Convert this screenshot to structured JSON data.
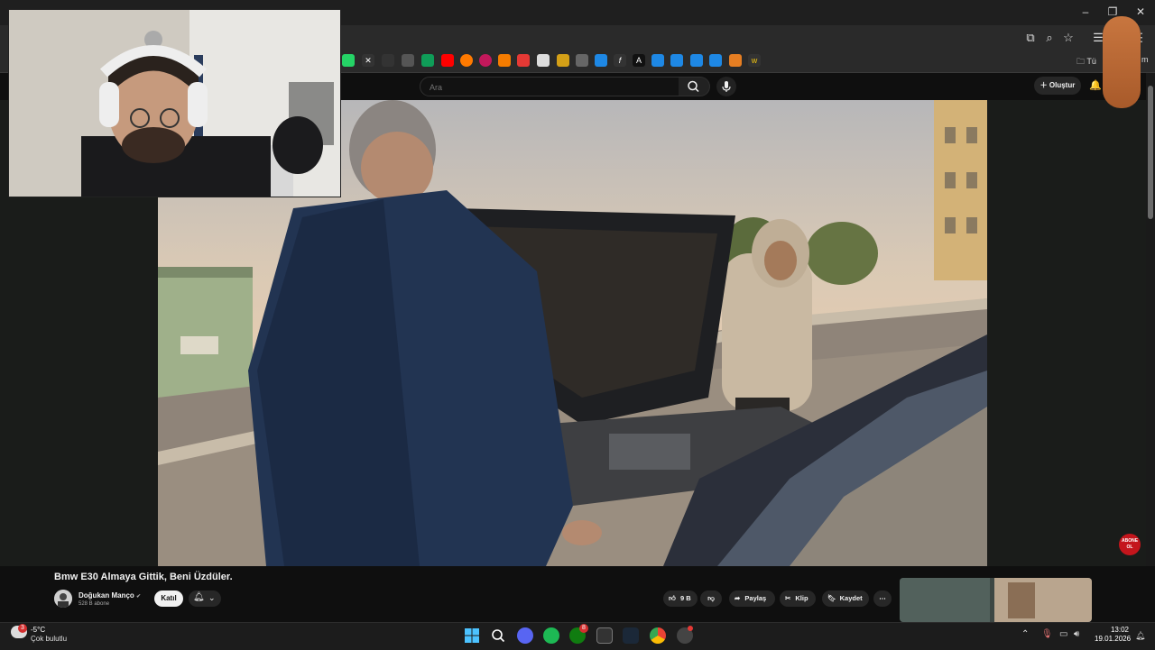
{
  "browser": {
    "bookmark_folder": "Tü",
    "bookmark_folder_right": "m",
    "window_controls": [
      "–",
      "❐",
      "✕"
    ]
  },
  "youtube": {
    "search_placeholder": "Ara",
    "create_label": "Oluştur"
  },
  "video": {
    "title": "Bmw E30 Almaya Gittik, Beni Üzdüler.",
    "channel": "Doğukan Manço",
    "verified": "✔",
    "subscribers": "528 B abone",
    "join_label": "Katıl",
    "likes": "9 B",
    "share_label": "Paylaş",
    "clip_label": "Klip",
    "save_label": "Kaydet",
    "more_label": "⋯"
  },
  "overlay": {
    "abone_line1": "ABONE",
    "abone_line2": "OL"
  },
  "taskbar": {
    "weather_badge": "3",
    "temperature": "-5°C",
    "weather_desc": "Çok bulutlu",
    "time": "13:02",
    "date": "19.01.2026",
    "xbox_badge": "8"
  },
  "colors": {
    "background": "#0f0f0f",
    "accent_red": "#c4151c",
    "pill": "#272727"
  }
}
